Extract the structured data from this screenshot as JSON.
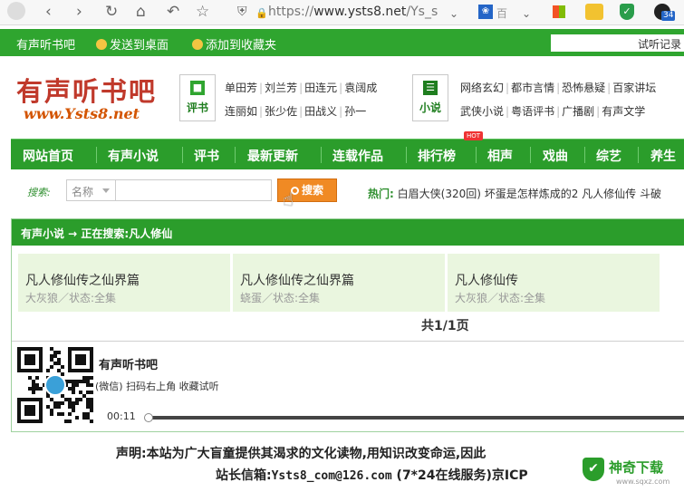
{
  "browser": {
    "url_prefix": "https://",
    "url_host": "www.ysts8.net",
    "url_rest": "/Ys_s",
    "ext_text": "百",
    "badge_count": "34",
    "icons": [
      "back-icon",
      "forward-icon",
      "reload-icon",
      "home-icon",
      "undo-icon",
      "star-icon",
      "shield-icon",
      "lock-icon"
    ]
  },
  "topbar": {
    "site": "有声听书吧",
    "send_desktop": "发送到桌面",
    "add_favorite": "添加到收藏夹",
    "history": "试听记录"
  },
  "logo": {
    "main": "有声听书吧",
    "sub": "www.Ysts8.net"
  },
  "pingshu": {
    "label": "评书",
    "row1": [
      "单田芳",
      "刘兰芳",
      "田连元",
      "袁阔成"
    ],
    "row2": [
      "连丽如",
      "张少佐",
      "田战义",
      "孙一"
    ]
  },
  "xiaoshuo": {
    "label": "小说",
    "row1": [
      "网络玄幻",
      "都市言情",
      "恐怖悬疑",
      "百家讲坛"
    ],
    "row2": [
      "武侠小说",
      "粤语评书",
      "广播剧",
      "有声文学"
    ]
  },
  "nav": {
    "items": [
      "网站首页",
      "有声小说",
      "评书",
      "最新更新",
      "连载作品",
      "排行榜",
      "相声",
      "戏曲",
      "综艺",
      "养生"
    ],
    "hot_badge": "HOT"
  },
  "search": {
    "label": "搜索:",
    "select_value": "名称",
    "input_value": "",
    "button": "搜索",
    "hot_label": "热门:",
    "hot_items": "白眉大侠(320回) 坏蛋是怎样炼成的2 凡人修仙传 斗破"
  },
  "results": {
    "breadcrumb": "有声小说 → 正在搜索:凡人修仙",
    "cards": [
      {
        "title": "凡人修仙传之仙界篇",
        "sub": "大灰狼／状态:全集"
      },
      {
        "title": "凡人修仙传之仙界篇",
        "sub": "蛲蛋／状态:全集"
      },
      {
        "title": "凡人修仙传",
        "sub": "大灰狼／状态:全集"
      }
    ],
    "pager": "共1/1页"
  },
  "promo": {
    "site_name": "有声听书吧",
    "wechat_tip": "(微信) 扫码右上角 收藏试听",
    "time": "00:11",
    "progress": 0
  },
  "footer": {
    "statement": "声明:本站为广大盲童提供其渴求的文化读物,用知识改变命运,因此",
    "email_label": "站长信箱:",
    "email": "Ysts8_com@126.com",
    "email_note": "(7*24在线服务)京ICP"
  },
  "watermark": {
    "name": "神奇下载",
    "domain": "www.sqxz.com"
  }
}
